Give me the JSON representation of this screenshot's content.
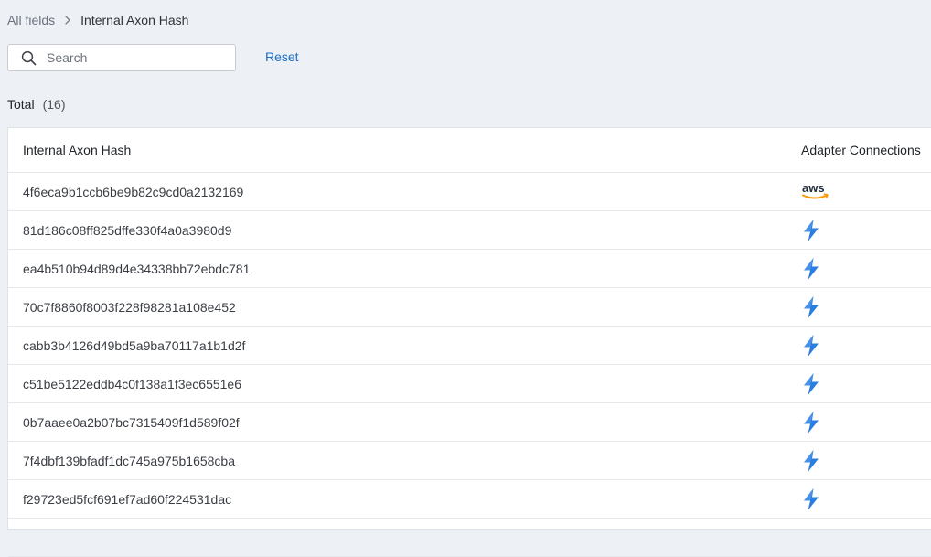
{
  "breadcrumb": {
    "root": "All fields",
    "current": "Internal Axon Hash"
  },
  "search": {
    "placeholder": "Search",
    "value": ""
  },
  "reset_label": "Reset",
  "total": {
    "label": "Total",
    "count": "(16)"
  },
  "table": {
    "columns": [
      "Internal Axon Hash",
      "Adapter Connections"
    ],
    "rows": [
      {
        "hash": "4f6eca9b1ccb6be9b82c9cd0a2132169",
        "adapter": "aws"
      },
      {
        "hash": "81d186c08ff825dffe330f4a0a3980d9",
        "adapter": "lightning-bolt"
      },
      {
        "hash": "ea4b510b94d89d4e34338bb72ebdc781",
        "adapter": "lightning-bolt"
      },
      {
        "hash": "70c7f8860f8003f228f98281a108e452",
        "adapter": "lightning-bolt"
      },
      {
        "hash": "cabb3b4126d49bd5a9ba70117a1b1d2f",
        "adapter": "lightning-bolt"
      },
      {
        "hash": "c51be5122eddb4c0f138a1f3ec6551e6",
        "adapter": "lightning-bolt"
      },
      {
        "hash": "0b7aaee0a2b07bc7315409f1d589f02f",
        "adapter": "lightning-bolt"
      },
      {
        "hash": "7f4dbf139bfadf1dc745a975b1658cba",
        "adapter": "lightning-bolt"
      },
      {
        "hash": "f29723ed5fcf691ef7ad60f224531dac",
        "adapter": "lightning-bolt"
      },
      {
        "hash": "",
        "adapter": ""
      }
    ]
  },
  "colors": {
    "background": "#edf0f4",
    "link": "#1f6fc5",
    "bolt": "#2a7de1",
    "aws_text": "#232f3e",
    "aws_smile": "#ff9900"
  }
}
